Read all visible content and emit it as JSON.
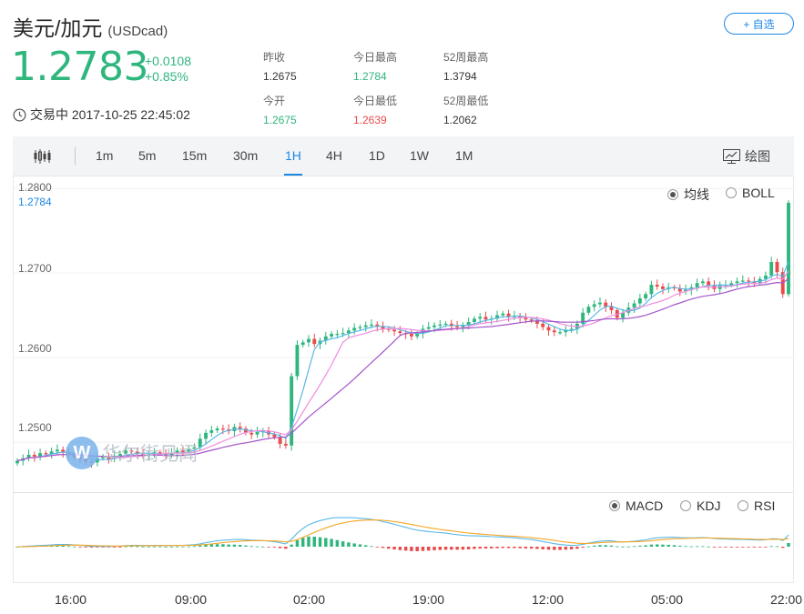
{
  "header": {
    "title": "美元/加元",
    "code": "(USDcad)",
    "add_watchlist": "+ 自选",
    "price": "1.2783",
    "change_abs": "+0.0108",
    "change_pct": "+0.85%",
    "trade_time": "交易中 2017-10-25 22:45:02"
  },
  "stats": [
    {
      "label": "昨收",
      "value": "1.2675",
      "tone": "neutral"
    },
    {
      "label": "今日最高",
      "value": "1.2784",
      "tone": "up"
    },
    {
      "label": "52周最高",
      "value": "1.3794",
      "tone": "neutral"
    },
    {
      "label": "今开",
      "value": "1.2675",
      "tone": "up"
    },
    {
      "label": "今日最低",
      "value": "1.2639",
      "tone": "down"
    },
    {
      "label": "52周最低",
      "value": "1.2062",
      "tone": "neutral"
    }
  ],
  "toolbar": {
    "intervals": [
      "1m",
      "5m",
      "15m",
      "30m",
      "1H",
      "4H",
      "1D",
      "1W",
      "1M"
    ],
    "active_interval": "1H",
    "draw_label": "绘图"
  },
  "main_chart": {
    "overlay_options": [
      {
        "label": "均线",
        "selected": true
      },
      {
        "label": "BOLL",
        "selected": false
      }
    ],
    "y_ticks": [
      "1.2800",
      "1.2700",
      "1.2600",
      "1.2500"
    ],
    "current_price_label": "1.2784",
    "watermark": "华尔街见闻"
  },
  "sub_chart": {
    "indicator_options": [
      {
        "label": "MACD",
        "selected": true
      },
      {
        "label": "KDJ",
        "selected": false
      },
      {
        "label": "RSI",
        "selected": false
      }
    ]
  },
  "x_ticks": [
    "16:00",
    "09:00",
    "02:00",
    "19:00",
    "12:00",
    "05:00",
    "22:00"
  ],
  "colors": {
    "up": "#2eb67d",
    "down": "#e94b4b",
    "accent": "#1e88e5",
    "ma_fast": "#5bb8e8",
    "ma_mid": "#f08ce0",
    "ma_slow": "#a455c9",
    "dea": "#f5a623"
  },
  "chart_data": {
    "type": "candlestick",
    "title": "",
    "xlabel": "",
    "ylabel": "",
    "y_range": [
      1.2442,
      1.2813
    ],
    "x_tick_labels": [
      "16:00",
      "09:00",
      "02:00",
      "19:00",
      "12:00",
      "05:00",
      "22:00"
    ],
    "close_series": [
      1.2478,
      1.2481,
      1.2485,
      1.2483,
      1.2487,
      1.2486,
      1.2489,
      1.2491,
      1.2488,
      1.2485,
      1.2482,
      1.248,
      1.2477,
      1.2476,
      1.2481,
      1.2483,
      1.248,
      1.2484,
      1.2486,
      1.249,
      1.2489,
      1.2486,
      1.2484,
      1.2486,
      1.2488,
      1.2487,
      1.2485,
      1.2487,
      1.249,
      1.2488,
      1.2492,
      1.2494,
      1.2504,
      1.2511,
      1.2514,
      1.2516,
      1.2515,
      1.2513,
      1.2518,
      1.2516,
      1.2511,
      1.2509,
      1.2512,
      1.2513,
      1.2509,
      1.2506,
      1.2498,
      1.2496,
      1.2578,
      1.2615,
      1.2618,
      1.2622,
      1.2616,
      1.262,
      1.2625,
      1.2628,
      1.2628,
      1.2629,
      1.2632,
      1.2635,
      1.2636,
      1.2638,
      1.2639,
      1.2637,
      1.2634,
      1.2633,
      1.2631,
      1.2629,
      1.2628,
      1.2625,
      1.2628,
      1.2634,
      1.2636,
      1.2638,
      1.2639,
      1.264,
      1.2637,
      1.2636,
      1.2638,
      1.2642,
      1.2646,
      1.2648,
      1.2645,
      1.2646,
      1.265,
      1.2652,
      1.2648,
      1.2649,
      1.2647,
      1.2645,
      1.2644,
      1.264,
      1.2636,
      1.2632,
      1.263,
      1.263,
      1.2633,
      1.2634,
      1.264,
      1.2653,
      1.266,
      1.2663,
      1.2665,
      1.266,
      1.2656,
      1.2647,
      1.2653,
      1.2659,
      1.2664,
      1.267,
      1.2675,
      1.2686,
      1.2684,
      1.2681,
      1.2683,
      1.2682,
      1.2678,
      1.268,
      1.2683,
      1.2688,
      1.269,
      1.2685,
      1.2681,
      1.2686,
      1.2686,
      1.2688,
      1.269,
      1.2691,
      1.269,
      1.2688,
      1.2693,
      1.2697,
      1.2713,
      1.2701,
      1.2675,
      1.2783
    ]
  }
}
